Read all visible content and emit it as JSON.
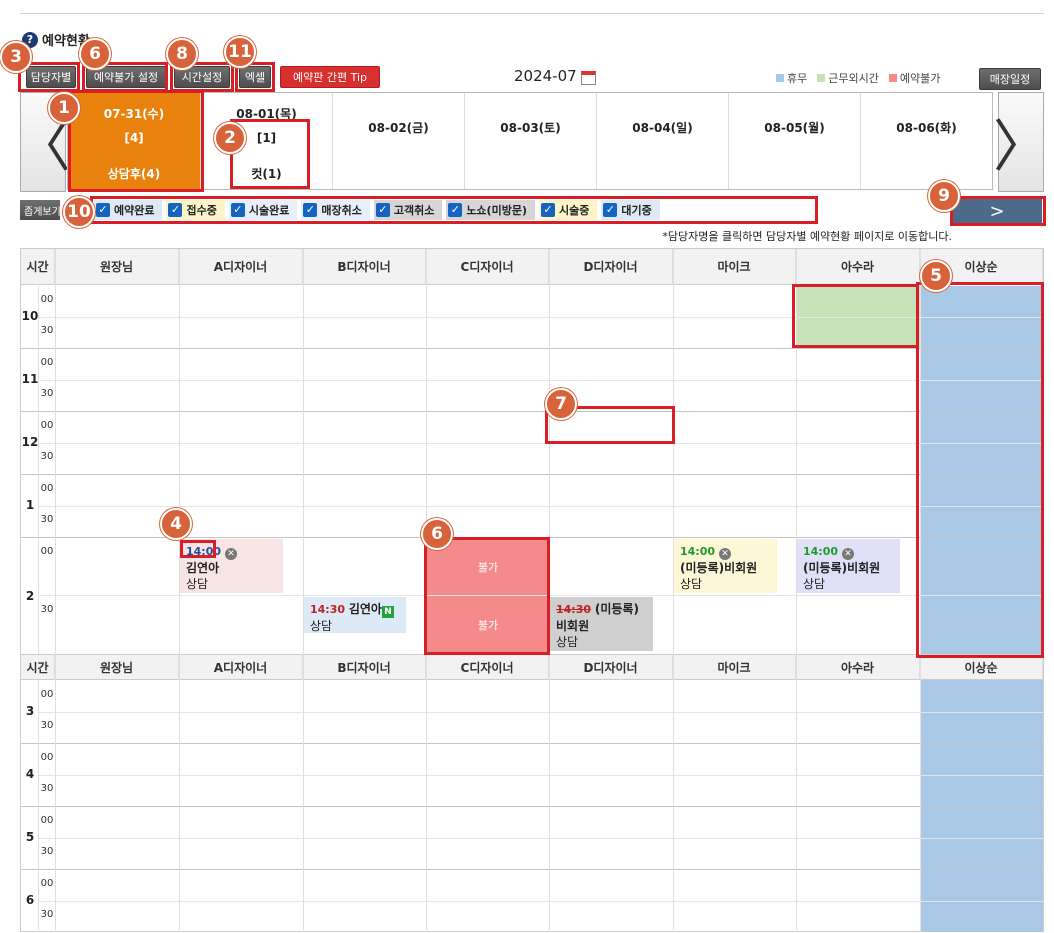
{
  "page": {
    "title": "예약현황",
    "month": "2024-07",
    "notice": "*담당자명을 클릭하면 담당자별 예약현황 페이지로 이동합니다."
  },
  "toolbar": {
    "by_staff": "담당자별",
    "block_setting": "예약불가 설정",
    "time_setting": "시간설정",
    "excel": "엑셀",
    "tip": "예약판 간편 Tip",
    "store_schedule": "매장일정",
    "tally": "좁게보기"
  },
  "legend": [
    {
      "label": "휴무",
      "color": "#a8c8e6"
    },
    {
      "label": "근무외시간",
      "color": "#c6e2b8"
    },
    {
      "label": "예약불가",
      "color": "#f48a8a"
    }
  ],
  "nav": {
    "prev": "〈",
    "next": "〉",
    "next_small": ">"
  },
  "dates": [
    {
      "label": "07-31(수)",
      "count": "[4]",
      "summary": "상담후(4)",
      "active": true
    },
    {
      "label": "08-01(목)",
      "count": "[1]",
      "summary": "컷(1)"
    },
    {
      "label": "08-02(금)"
    },
    {
      "label": "08-03(토)"
    },
    {
      "label": "08-04(일)"
    },
    {
      "label": "08-05(월)"
    },
    {
      "label": "08-06(화)"
    }
  ],
  "filters": [
    {
      "label": "예약완료",
      "bg": "#dde9f6"
    },
    {
      "label": "접수중",
      "bg": "#fdf5c9"
    },
    {
      "label": "시술완료",
      "bg": "#e6effa"
    },
    {
      "label": "매장취소",
      "bg": "#e6effa"
    },
    {
      "label": "고객취소",
      "bg": "#d6d6d6"
    },
    {
      "label": "노쇼(미방문)",
      "bg": "#d6d6d6"
    },
    {
      "label": "시술중",
      "bg": "#fdf5c9"
    },
    {
      "label": "대기중",
      "bg": "#dde9f6"
    }
  ],
  "grid": {
    "time_header": "시간",
    "columns": [
      "원장님",
      "A디자이너",
      "B디자이너",
      "C디자이너",
      "D디자이너",
      "마이크",
      "아수라",
      "이상순"
    ],
    "hours_top": [
      "10",
      "11",
      "12",
      "1",
      "2"
    ],
    "hours_bottom": [
      "3",
      "4",
      "5",
      "6"
    ],
    "min_00": "00",
    "min_30": "30",
    "blocked_label": "불가"
  },
  "appointments": {
    "a1": {
      "time": "14:00",
      "name": "김연아",
      "service": "상담"
    },
    "a2": {
      "time": "14:30",
      "name": "김연아",
      "service": "상담",
      "badge": "N"
    },
    "a3": {
      "time": "14:30",
      "name": "(미등록)비회원",
      "service": "상담"
    },
    "a4": {
      "time": "14:00",
      "name": "(미등록)비회원",
      "service": "상담"
    },
    "a5": {
      "time": "14:00",
      "name": "(미등록)비회원",
      "service": "상담"
    }
  },
  "annotations": [
    "1",
    "2",
    "3",
    "4",
    "5",
    "6",
    "7",
    "8",
    "9",
    "10",
    "11"
  ]
}
